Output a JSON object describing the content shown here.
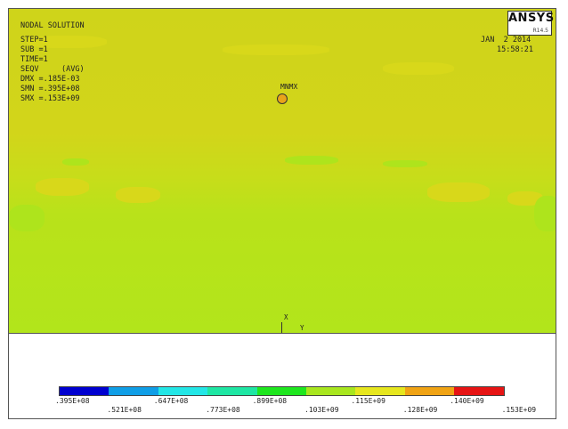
{
  "header": {
    "title": "NODAL SOLUTION",
    "step": "STEP=1",
    "sub": "SUB =1",
    "time": "TIME=1",
    "seqv": "SEQV     (AVG)",
    "dmx": "DMX =.185E-03",
    "smn": "SMN =.395E+08",
    "smx": "SMX =.153E+09",
    "date": "JAN  2 2014",
    "clock": "15:58:21"
  },
  "logo": {
    "name": "ANSYS",
    "version": "R14.5"
  },
  "markers": {
    "mx": "MX",
    "mn": "MN",
    "axis_x": "X",
    "axis_y": "Y"
  },
  "legend": {
    "colors": [
      "#0000d0",
      "#0f9ee6",
      "#23e6e6",
      "#1ee6a3",
      "#1ee61e",
      "#a8e61e",
      "#e6e61e",
      "#f0a314",
      "#e61414"
    ],
    "labels_top": [
      ".395E+08",
      ".647E+08",
      ".899E+08",
      ".115E+09",
      ".140E+09"
    ],
    "labels_bottom": [
      ".521E+08",
      ".773E+08",
      ".103E+09",
      ".128E+09",
      ".153E+09"
    ]
  }
}
